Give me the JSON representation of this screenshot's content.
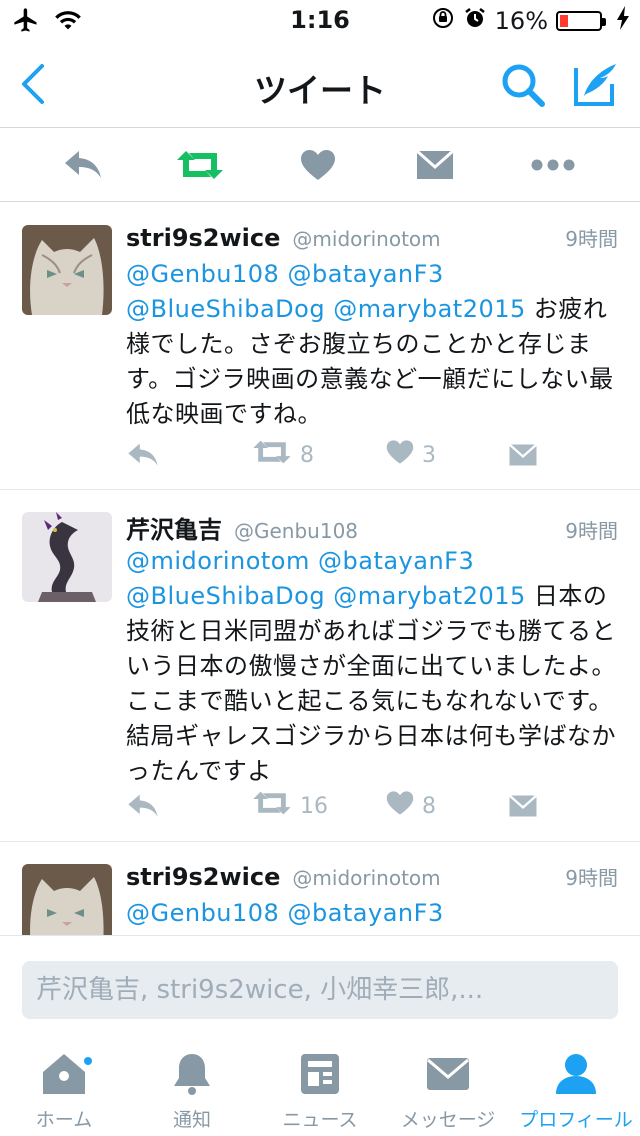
{
  "status_bar": {
    "time": "1:16",
    "battery_percent": "16%",
    "icons": [
      "airplane-icon",
      "wifi-icon",
      "orientation-lock-icon",
      "alarm-icon",
      "battery-icon",
      "charging-icon"
    ]
  },
  "nav": {
    "title": "ツイート",
    "back_icon": "chevron-left-icon",
    "search_icon": "search-icon",
    "compose_icon": "compose-tweet-icon"
  },
  "action_toolbar": {
    "icons": [
      "reply-icon",
      "retweet-icon",
      "like-icon",
      "direct-message-icon",
      "more-icon"
    ],
    "retweet_active_color": "#17bf63"
  },
  "tweets": [
    {
      "name": "stri9s2wice",
      "handle": "@midorinotom",
      "time": "9時間",
      "mentions": "@Genbu108 @batayanF3 @BlueShibaDog @marybat2015",
      "body": " お疲れ様でした。さぞお腹立ちのことかと存じます。ゴジラ映画の意義など一顧だにしない最低な映画ですね。",
      "retweets": "8",
      "likes": "3"
    },
    {
      "name": "芹沢亀吉",
      "handle": "@Genbu108",
      "time": "9時間",
      "mentions": "@midorinotom @batayanF3 @BlueShibaDog @marybat2015",
      "body": " 日本の技術と日米同盟があればゴジラでも勝てるという日本の傲慢さが全面に出ていましたよ。ここまで酷いと起こる気にもなれないです。結局ギャレスゴジラから日本は何も学ばなかったんですよ",
      "retweets": "16",
      "likes": "8"
    },
    {
      "name": "stri9s2wice",
      "handle": "@midorinotom",
      "time": "9時間",
      "mentions": "@Genbu108 @batayanF3",
      "body": ""
    }
  ],
  "reply": {
    "placeholder": "芹沢亀吉, stri9s2wice, 小畑幸三郎,..."
  },
  "tabs": [
    {
      "label": "ホーム",
      "icon": "home-icon"
    },
    {
      "label": "通知",
      "icon": "bell-icon"
    },
    {
      "label": "ニュース",
      "icon": "news-icon"
    },
    {
      "label": "メッセージ",
      "icon": "message-icon"
    },
    {
      "label": "プロフィール",
      "icon": "profile-icon",
      "active": true
    }
  ],
  "colors": {
    "accent": "#1da1f2",
    "mention": "#1b95e0",
    "secondary_text": "#8899a6",
    "icon_gray": "#aab8c2"
  }
}
